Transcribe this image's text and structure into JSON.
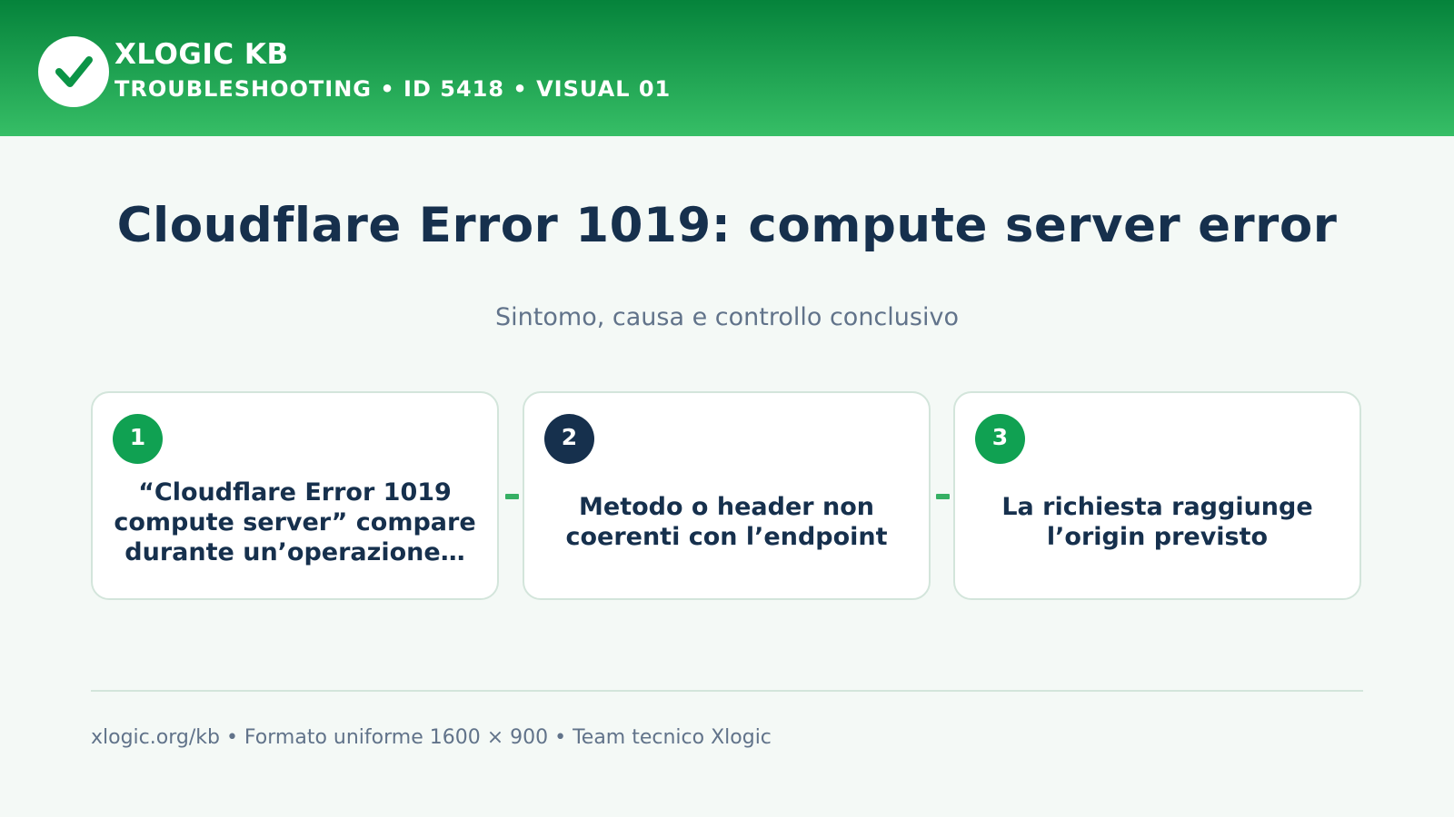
{
  "header": {
    "brand": "XLOGIC KB",
    "breadcrumb": "TROUBLESHOOTING • ID 5418 • VISUAL 01",
    "logo_icon": "checkmark-icon"
  },
  "main": {
    "title": "Cloudflare Error 1019: compute server error",
    "subtitle": "Sintomo, causa e controllo conclusivo",
    "steps": [
      {
        "number": "1",
        "text": "“Cloudflare Error 1019 compute server” compare durante un’operazione…",
        "badge_color": "#10a152"
      },
      {
        "number": "2",
        "text": "Metodo o header non coerenti con l’endpoint",
        "badge_color": "#16304d"
      },
      {
        "number": "3",
        "text": "La richiesta raggiunge l’origin previsto",
        "badge_color": "#10a152"
      }
    ]
  },
  "footer": {
    "text": "xlogic.org/kb • Formato uniforme 1600 × 900 • Team tecnico Xlogic"
  },
  "colors": {
    "header_dark": "#05833b",
    "header_light": "#36be66",
    "accent_green": "#10a152",
    "navy": "#16304d",
    "muted": "#61738a",
    "background": "#f4f9f6"
  }
}
